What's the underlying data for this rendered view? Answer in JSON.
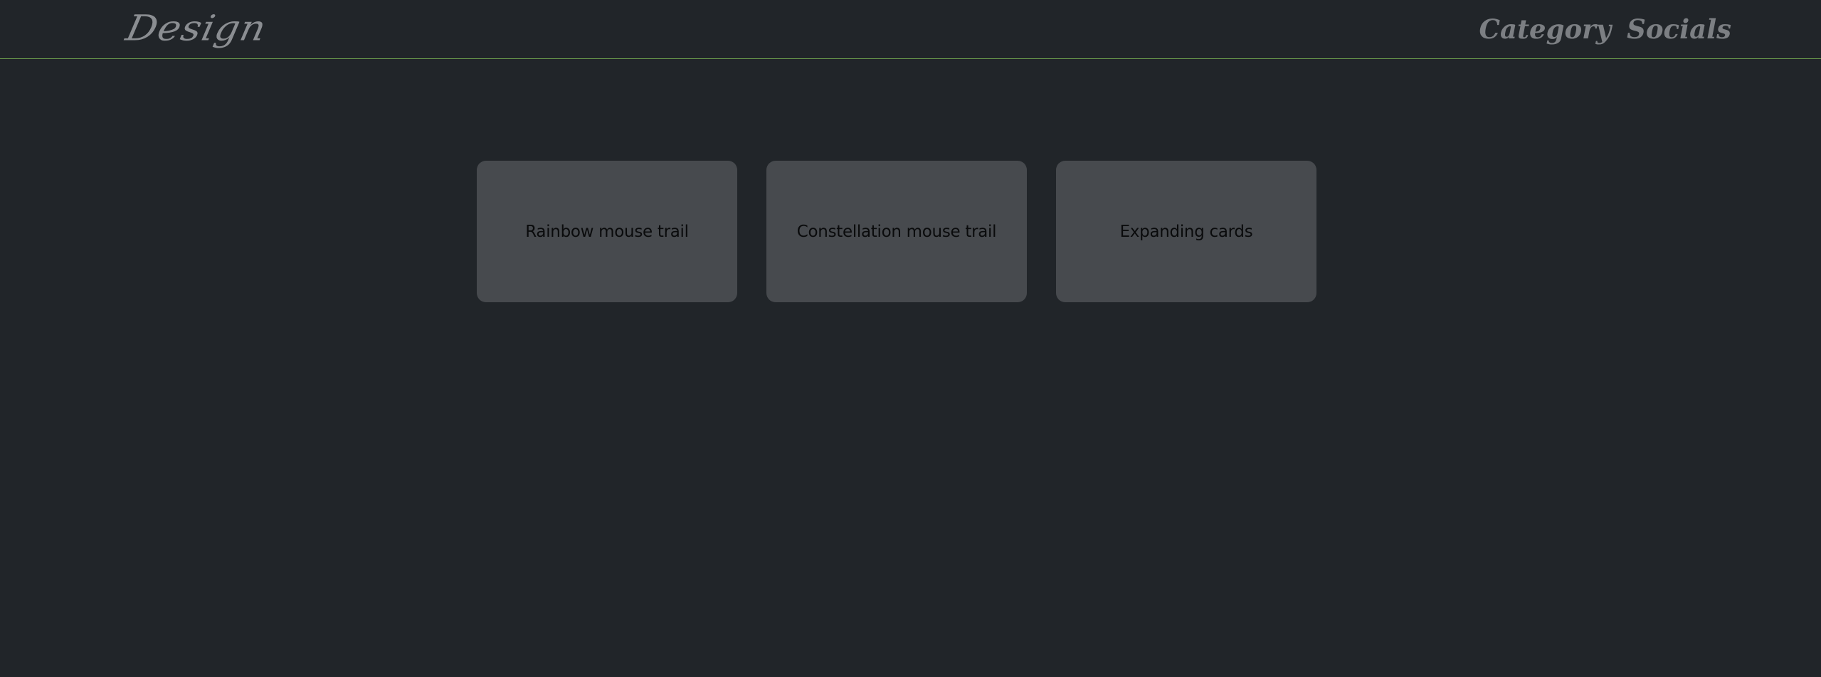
{
  "header": {
    "logo_text": "Design",
    "nav": [
      {
        "label": "Category"
      },
      {
        "label": "Socials"
      }
    ]
  },
  "cards": [
    {
      "label": "Rainbow mouse trail"
    },
    {
      "label": "Constellation mouse trail"
    },
    {
      "label": "Expanding cards"
    }
  ],
  "colors": {
    "background": "#212529",
    "card_background": "#474a4e",
    "header_border": "#6a9a4b",
    "nav_text": "#7c7f83",
    "logo_text": "#8b8e92"
  }
}
